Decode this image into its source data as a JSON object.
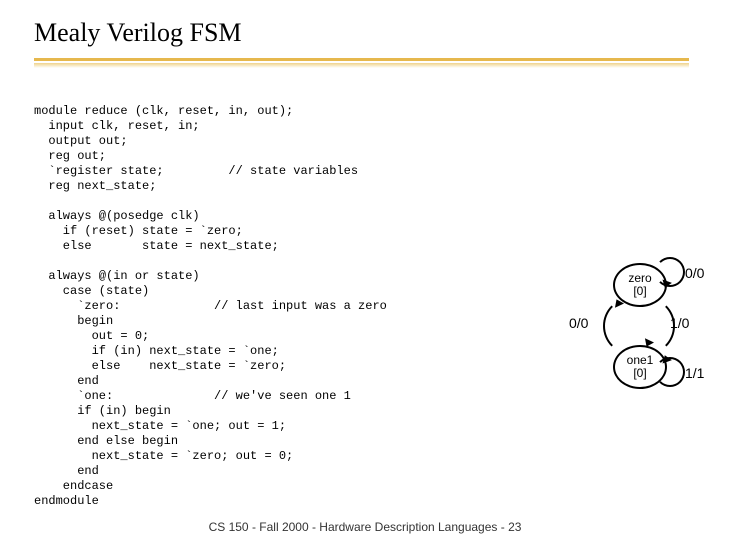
{
  "title": "Mealy Verilog FSM",
  "code_lines": [
    "module reduce (clk, reset, in, out);",
    "  input clk, reset, in;",
    "  output out;",
    "  reg out;",
    "  `register state;         // state variables",
    "  reg next_state;",
    "",
    "  always @(posedge clk)",
    "    if (reset) state = `zero;",
    "    else       state = next_state;",
    "",
    "  always @(in or state)",
    "    case (state)",
    "      `zero:             // last input was a zero",
    "      begin",
    "        out = 0;",
    "        if (in) next_state = `one;",
    "        else    next_state = `zero;",
    "      end",
    "      `one:              // we've seen one 1",
    "      if (in) begin",
    "        next_state = `one; out = 1;",
    "      end else begin",
    "        next_state = `zero; out = 0;",
    "      end",
    "    endcase",
    "endmodule"
  ],
  "footer": "CS 150 - Fall 2000 - Hardware Description Languages - 23",
  "diagram": {
    "state_zero": {
      "name": "zero",
      "output": "[0]"
    },
    "state_one": {
      "name": "one1",
      "output": "[0]"
    },
    "edge_zero_self": "0/0",
    "edge_zero_to_one": "1/0",
    "edge_one_to_zero": "0/0",
    "edge_one_self": "1/1"
  }
}
